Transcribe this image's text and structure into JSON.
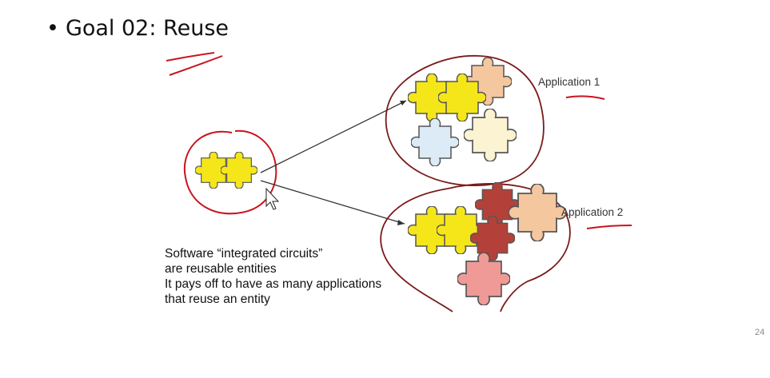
{
  "slide": {
    "bullet": "•",
    "title": "Goal 02: Reuse",
    "page_number": "24"
  },
  "figure": {
    "labels": {
      "app1": "Application 1",
      "app2": "Application 2"
    },
    "caption": [
      "Software “integrated circuits”",
      "are reusable entities",
      "It pays off to have as many applications",
      "that reuse an entity"
    ]
  },
  "colors": {
    "ink_red": "#c8141e",
    "outline_dark_red": "#7a1a1a",
    "piece_yellow": "#f5e61a",
    "piece_peach": "#f4c79f",
    "piece_lightblue": "#dcebf5",
    "piece_cream": "#fbf3d2",
    "piece_darkred": "#b3413a",
    "piece_pink": "#ef9a96"
  }
}
